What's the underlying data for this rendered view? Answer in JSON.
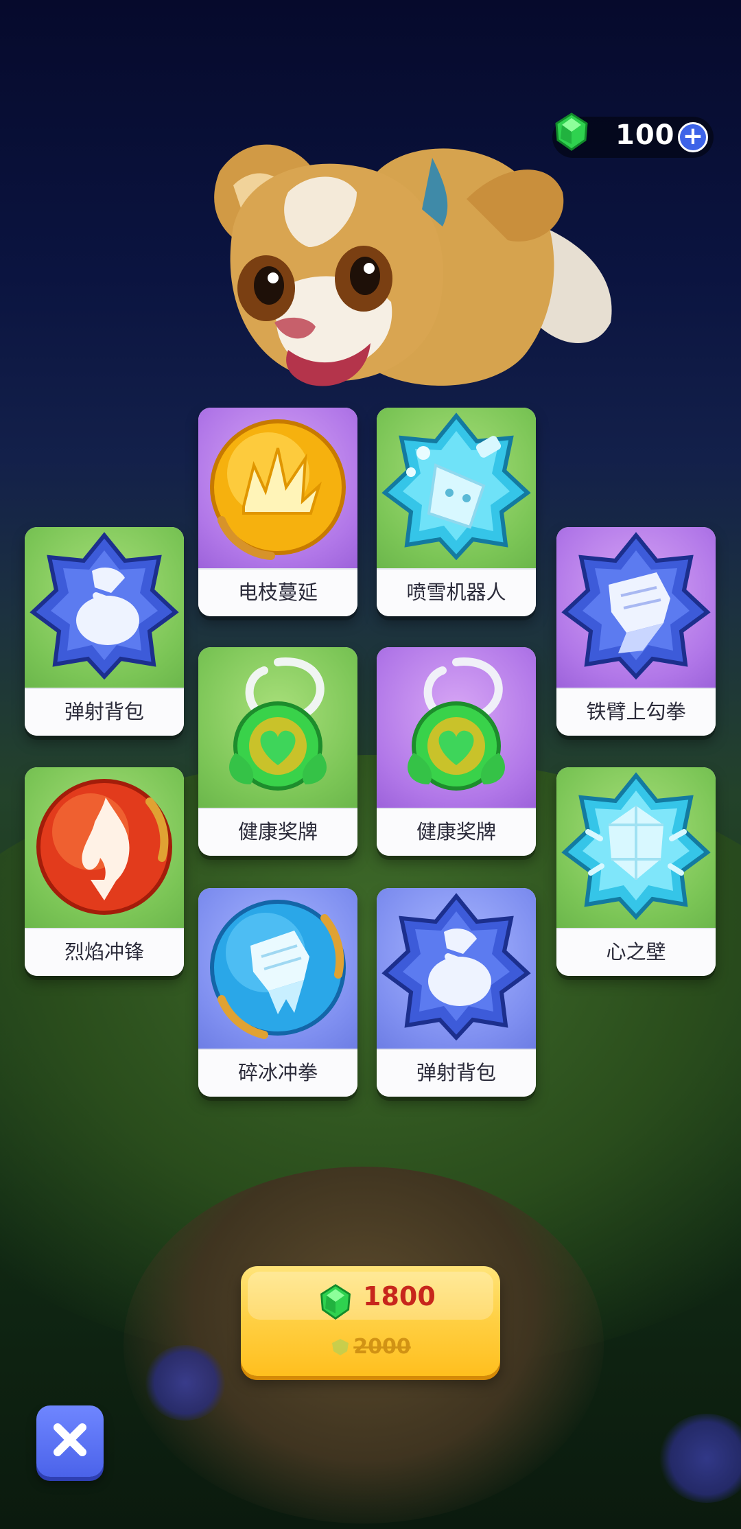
{
  "currency": {
    "amount": "100",
    "add_icon": "plus-icon",
    "gem_icon": "green-gem-icon"
  },
  "cards": [
    {
      "label": "电枝蔓延",
      "theme": "purple",
      "icon": "lightning-burst-orb-icon"
    },
    {
      "label": "喷雪机器人",
      "theme": "green",
      "icon": "snow-robot-badge-icon"
    },
    {
      "label": "弹射背包",
      "theme": "green",
      "icon": "jetpack-badge-icon"
    },
    {
      "label": "铁臂上勾拳",
      "theme": "purple",
      "icon": "fist-badge-icon"
    },
    {
      "label": "健康奖牌",
      "theme": "green",
      "icon": "heart-medal-icon"
    },
    {
      "label": "健康奖牌",
      "theme": "purple",
      "icon": "heart-medal-icon"
    },
    {
      "label": "烈焰冲锋",
      "theme": "green",
      "icon": "flame-orb-icon"
    },
    {
      "label": "心之壁",
      "theme": "green",
      "icon": "crystal-shield-badge-icon"
    },
    {
      "label": "碎冰冲拳",
      "theme": "blue",
      "icon": "ice-fist-orb-icon"
    },
    {
      "label": "弹射背包",
      "theme": "blue",
      "icon": "jetpack-badge-icon"
    }
  ],
  "buy_button": {
    "price": "1800",
    "original_price": "2000"
  },
  "close_button": {
    "icon": "close-x-icon"
  }
}
